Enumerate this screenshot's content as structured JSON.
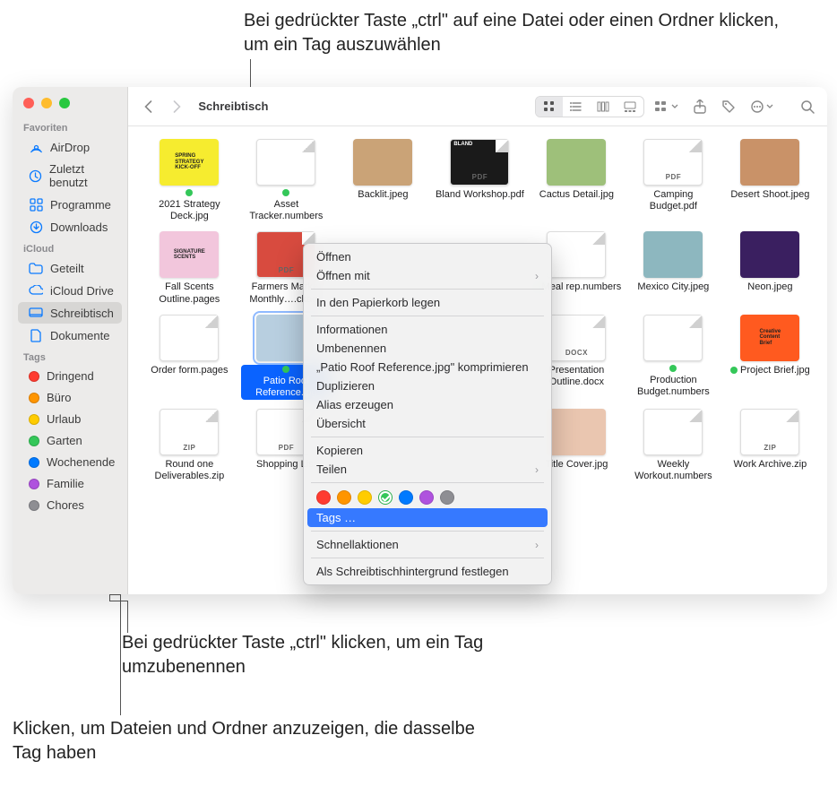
{
  "callouts": {
    "top": "Bei gedrückter Taste „ctrl\" auf eine Datei oder einen Ordner klicken, um ein Tag auszuwählen",
    "mid": "Bei gedrückter Taste „ctrl\" klicken, um ein Tag umzubenennen",
    "bot": "Klicken, um Dateien und Ordner anzuzeigen, die dasselbe Tag haben"
  },
  "toolbar": {
    "title": "Schreibtisch"
  },
  "sidebar": {
    "sections": [
      {
        "heading": "Favoriten",
        "items": [
          {
            "label": "AirDrop",
            "icon": "airdrop"
          },
          {
            "label": "Zuletzt benutzt",
            "icon": "clock"
          },
          {
            "label": "Programme",
            "icon": "grid"
          },
          {
            "label": "Downloads",
            "icon": "download"
          }
        ]
      },
      {
        "heading": "iCloud",
        "items": [
          {
            "label": "Geteilt",
            "icon": "folder"
          },
          {
            "label": "iCloud Drive",
            "icon": "cloud"
          },
          {
            "label": "Schreibtisch",
            "icon": "desktop",
            "selected": true
          },
          {
            "label": "Dokumente",
            "icon": "doc"
          }
        ]
      },
      {
        "heading": "Tags",
        "items": [
          {
            "label": "Dringend",
            "color": "#ff3b30"
          },
          {
            "label": "Büro",
            "color": "#ff9500"
          },
          {
            "label": "Urlaub",
            "color": "#ffcc00"
          },
          {
            "label": "Garten",
            "color": "#34c759"
          },
          {
            "label": "Wochenende",
            "color": "#007aff"
          },
          {
            "label": "Familie",
            "color": "#af52de"
          },
          {
            "label": "Chores",
            "color": "#8e8e93"
          }
        ]
      }
    ]
  },
  "files": [
    {
      "name": "2021 Strategy Deck.jpg",
      "tag": "#34c759",
      "kind": "img",
      "bg": "#f6ec2f",
      "txt": "SPRING\\nSTRATEGY\\nKICK-OFF"
    },
    {
      "name": "Asset Tracker.numbers",
      "tag": "#34c759",
      "kind": "doc",
      "badge": ""
    },
    {
      "name": "Backlit.jpeg",
      "kind": "img",
      "bg": "#caa377"
    },
    {
      "name": "Bland Workshop.pdf",
      "kind": "doc",
      "badge": "PDF",
      "dark": true,
      "toptext": "BLAND"
    },
    {
      "name": "Cactus Detail.jpg",
      "kind": "img",
      "bg": "#9ec07a"
    },
    {
      "name": "Camping Budget.pdf",
      "kind": "doc",
      "badge": "PDF"
    },
    {
      "name": "Desert Shoot.jpeg",
      "kind": "img",
      "bg": "#c99268"
    },
    {
      "name": "Fall Scents Outline.pages",
      "kind": "img",
      "bg": "#f2c6dc",
      "txt": "SIGNATURE\\nSCENTS"
    },
    {
      "name": "Farmers Market Monthly….ckage",
      "kind": "doc",
      "badge": "PDF",
      "bg": "#d84b3f"
    },
    {
      "name": "",
      "kind": "hidden"
    },
    {
      "name": "",
      "kind": "hidden"
    },
    {
      "name": "Meal rep.numbers",
      "tag": "#34c759",
      "kind": "doc"
    },
    {
      "name": "Mexico City.jpeg",
      "kind": "img",
      "bg": "#8db7bf"
    },
    {
      "name": "Neon.jpeg",
      "kind": "img",
      "bg": "#3a1f60"
    },
    {
      "name": "Order form.pages",
      "kind": "doc"
    },
    {
      "name": "Patio Roof Reference.jpg",
      "tag": "#34c759",
      "kind": "img",
      "bg": "#b8cfe0",
      "selected": true
    },
    {
      "name": "",
      "kind": "hidden"
    },
    {
      "name": "",
      "kind": "hidden"
    },
    {
      "name": "Presentation Outline.docx",
      "kind": "doc",
      "badge": "DOCX"
    },
    {
      "name": "Production Budget.numbers",
      "tag": "#34c759",
      "kind": "doc"
    },
    {
      "name": "Project Brief.jpg",
      "tag": "#34c759",
      "kind": "img",
      "bg": "#ff5a1f",
      "txt": "Creative\\nContent\\nBrief"
    },
    {
      "name": "Round one Deliverables.zip",
      "kind": "doc",
      "badge": "ZIP"
    },
    {
      "name": "Shopping List",
      "kind": "doc",
      "badge": "PDF"
    },
    {
      "name": "",
      "kind": "hidden"
    },
    {
      "name": "",
      "kind": "hidden"
    },
    {
      "name": "Title Cover.jpg",
      "kind": "img",
      "bg": "#eac6b0"
    },
    {
      "name": "Weekly Workout.numbers",
      "kind": "doc"
    },
    {
      "name": "Work Archive.zip",
      "kind": "doc",
      "badge": "ZIP"
    }
  ],
  "contextMenu": {
    "items1": [
      "Öffnen",
      "Öffnen mit"
    ],
    "items2": [
      "In den Papierkorb legen"
    ],
    "items3": [
      "Informationen",
      "Umbenennen",
      "„Patio Roof Reference.jpg\" komprimieren",
      "Duplizieren",
      "Alias erzeugen",
      "Übersicht"
    ],
    "items4": [
      "Kopieren",
      "Teilen"
    ],
    "tagColors": [
      "#ff3b30",
      "#ff9500",
      "#ffcc00",
      "#34c759",
      "#007aff",
      "#af52de",
      "#8e8e93"
    ],
    "tagsLabel": "Tags …",
    "items5": [
      "Schnellaktionen"
    ],
    "items6": [
      "Als Schreibtischhintergrund festlegen"
    ]
  }
}
